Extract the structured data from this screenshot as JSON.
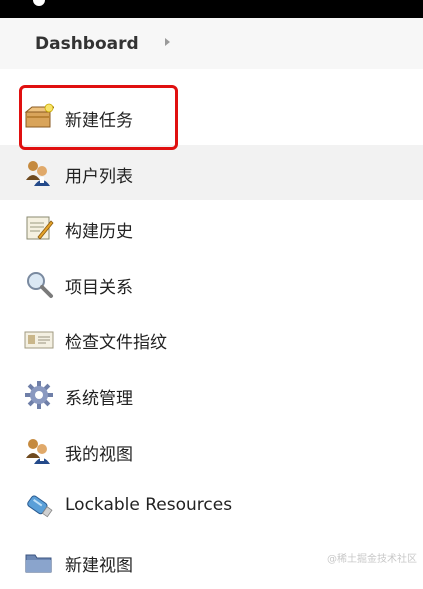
{
  "breadcrumb": {
    "root_label": "Dashboard"
  },
  "menu": {
    "items": [
      {
        "label": "新建任务",
        "icon": "new-job-icon"
      },
      {
        "label": "用户列表",
        "icon": "users-icon"
      },
      {
        "label": "构建历史",
        "icon": "build-history-icon"
      },
      {
        "label": "项目关系",
        "icon": "search-icon"
      },
      {
        "label": "检查文件指纹",
        "icon": "fingerprint-icon"
      },
      {
        "label": "系统管理",
        "icon": "gear-icon"
      },
      {
        "label": "我的视图",
        "icon": "my-views-icon"
      },
      {
        "label": "Lockable Resources",
        "icon": "usb-drive-icon"
      },
      {
        "label": "新建视图",
        "icon": "folder-icon"
      }
    ]
  },
  "watermark": {
    "text": "@稀土掘金技术社区"
  }
}
